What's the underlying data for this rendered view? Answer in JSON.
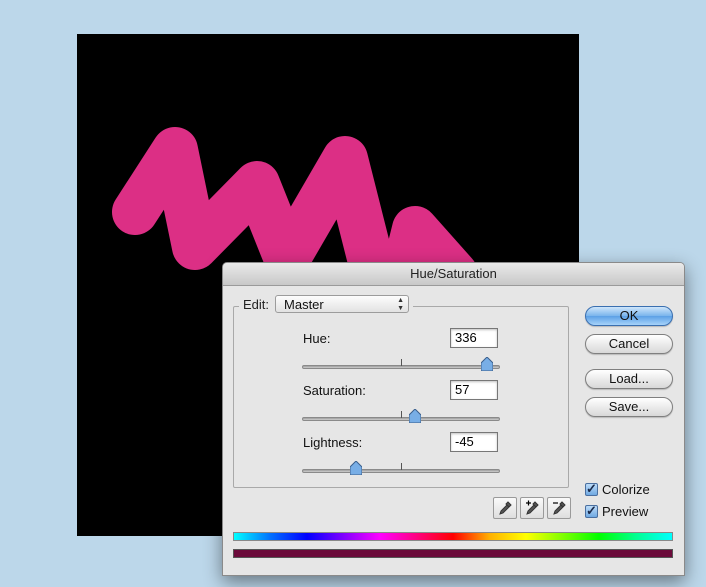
{
  "colors": {
    "canvas_background": "#000000",
    "stroke": "#dc2f85",
    "result_bar": "#6b0a3a",
    "desktop": "#bcd7ea"
  },
  "dialog": {
    "title": "Hue/Saturation",
    "edit": {
      "label": "Edit:",
      "selected": "Master"
    },
    "sliders": [
      {
        "label": "Hue:",
        "value": "336",
        "fraction": 0.933
      },
      {
        "label": "Saturation:",
        "value": "57",
        "fraction": 0.57
      },
      {
        "label": "Lightness:",
        "value": "-45",
        "fraction": 0.275
      }
    ],
    "buttons": {
      "ok": "OK",
      "cancel": "Cancel",
      "load": "Load...",
      "save": "Save..."
    },
    "checkboxes": {
      "colorize": {
        "label": "Colorize",
        "checked": true
      },
      "preview": {
        "label": "Preview",
        "checked": true
      }
    },
    "icons": [
      "eyedropper-icon",
      "eyedropper-plus-icon",
      "eyedropper-minus-icon"
    ]
  }
}
